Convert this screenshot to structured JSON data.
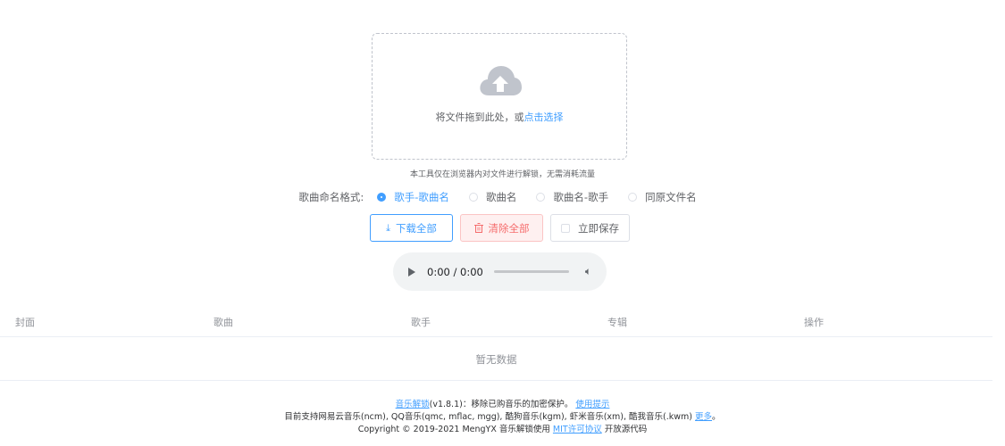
{
  "upload": {
    "text_prefix": "将文件拖到此处，或",
    "link": "点击选择"
  },
  "tip": "本工具仅在浏览器内对文件进行解锁，无需消耗流量",
  "naming": {
    "title": "歌曲命名格式:",
    "options": [
      "歌手-歌曲名",
      "歌曲名",
      "歌曲名-歌手",
      "同原文件名"
    ],
    "selected": "歌手-歌曲名"
  },
  "buttons": {
    "download_all": "下载全部",
    "clear_all": "清除全部",
    "save_now": "立即保存"
  },
  "audio": {
    "time": "0:00 / 0:00"
  },
  "table": {
    "headers": [
      "封面",
      "歌曲",
      "歌手",
      "专辑",
      "操作"
    ],
    "empty_text": "暂无数据"
  },
  "footer": {
    "app_link": "音乐解锁",
    "version_text": "(v1.8.1)：移除已购音乐的加密保护。",
    "usage_link": "使用提示",
    "support_text": "目前支持网易云音乐(ncm), QQ音乐(qmc, mflac, mgg), 酷狗音乐(kgm), 虾米音乐(xm), 酷我音乐(.kwm)",
    "more_link": "更多",
    "period": "。",
    "copyright_text": "Copyright © 2019-2021 MengYX 音乐解锁使用",
    "license_link": "MIT许可协议",
    "opensource_text": "开放源代码"
  },
  "colors": {
    "primary": "#409eff",
    "danger": "#f56c6c",
    "text": "#606266",
    "muted": "#909399"
  },
  "icons": {
    "upload": "cloud-upload-icon",
    "download": "download-icon",
    "delete": "trash-icon",
    "play": "play-icon",
    "volume": "volume-icon"
  }
}
